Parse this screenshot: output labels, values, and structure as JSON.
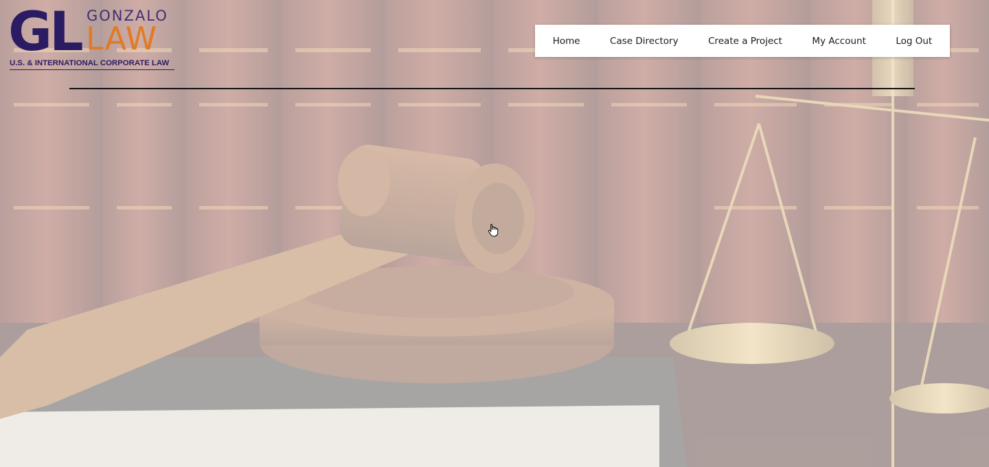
{
  "brand": {
    "monogram": "GL",
    "name_top": "GONZALO",
    "name_bottom": "LAW",
    "tagline": "U.S. & INTERNATIONAL CORPORATE LAW",
    "colors": {
      "primary": "#2b1b63",
      "accent": "#e07b24"
    }
  },
  "nav": {
    "items": [
      {
        "label": "Home"
      },
      {
        "label": "Case Directory"
      },
      {
        "label": "Create a Project"
      },
      {
        "label": "My Account"
      },
      {
        "label": "Log Out"
      }
    ]
  },
  "hero": {
    "image": "gavel-books-scales-background"
  },
  "cursor": {
    "icon": "hand-pointer-icon"
  }
}
